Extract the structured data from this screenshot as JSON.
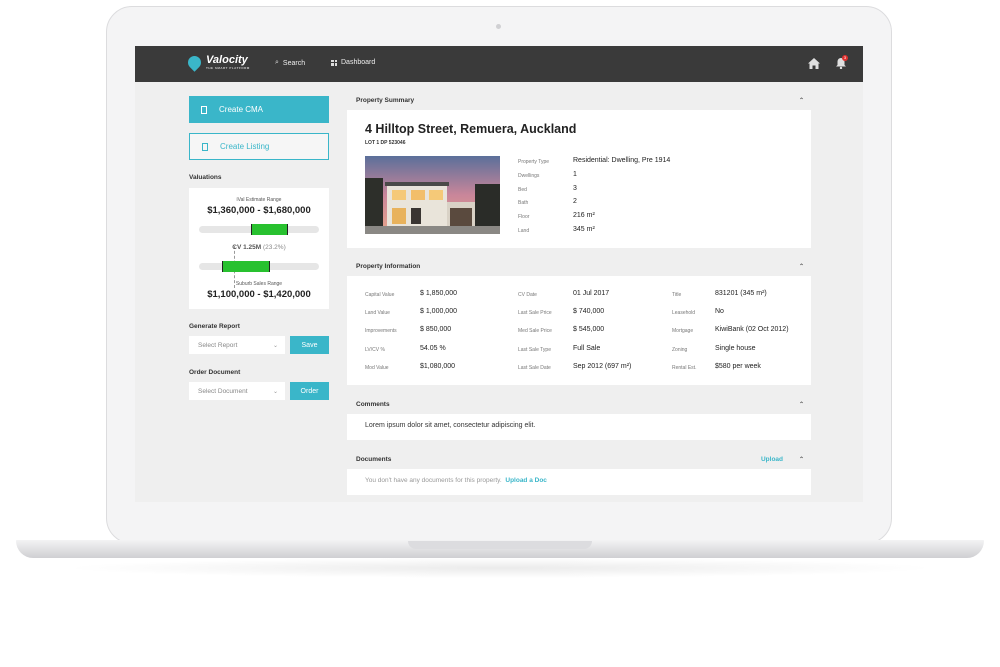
{
  "app": {
    "logo": "Valocity",
    "logo_sub": "THE SMART PLATFORM",
    "notification_count": "3"
  },
  "nav": {
    "search": "Search",
    "dashboard": "Dashboard"
  },
  "sidebar": {
    "create_cma": "Create CMA",
    "create_listing": "Create Listing",
    "valuations_label": "Valuations",
    "ival_caption": "iVal Estimate Range",
    "ival_range": "$1,360,000 - $1,680,000",
    "cv_label": "CV 1.25M",
    "cv_pct": "(23.2%)",
    "suburb_caption": "Suburb Sales Range",
    "suburb_range": "$1,100,000 - $1,420,000",
    "generate_report_label": "Generate Report",
    "report_placeholder": "Select Report",
    "save": "Save",
    "order_document_label": "Order Document",
    "document_placeholder": "Select Document",
    "order": "Order"
  },
  "summary": {
    "title": "Property Summary",
    "address": "4 Hilltop Street, Remuera, Auckland",
    "lot": "LOT 1 DP 523046",
    "fields": [
      {
        "label": "Property Type",
        "value": "Residential: Dwelling, Pre 1914"
      },
      {
        "label": "Dwellings",
        "value": "1"
      },
      {
        "label": "Bed",
        "value": "3"
      },
      {
        "label": "Bath",
        "value": "2"
      },
      {
        "label": "Floor",
        "value": "216 m²"
      },
      {
        "label": "Land",
        "value": "345 m²"
      }
    ]
  },
  "info": {
    "title": "Property Information",
    "col1": [
      {
        "label": "Capital Value",
        "value": "$ 1,850,000"
      },
      {
        "label": "Land Value",
        "value": "$ 1,000,000"
      },
      {
        "label": "Improvements",
        "value": "$ 850,000"
      },
      {
        "label": "LV/CV %",
        "value": "54.05 %"
      },
      {
        "label": "Mod Value",
        "value": "$1,080,000"
      }
    ],
    "col2": [
      {
        "label": "CV Date",
        "value": "01 Jul 2017"
      },
      {
        "label": "Last Sale Price",
        "value": "$ 740,000"
      },
      {
        "label": "Med Sale Price",
        "value": "$ 545,000"
      },
      {
        "label": "Last Sale Type",
        "value": "Full Sale"
      },
      {
        "label": "Last Sale Date",
        "value": "Sep 2012 (697 m²)"
      }
    ],
    "col3": [
      {
        "label": "Title",
        "value": "831201 (345 m²)"
      },
      {
        "label": "Leasehold",
        "value": "No"
      },
      {
        "label": "Mortgage",
        "value": "KiwiBank (02 Oct 2012)"
      },
      {
        "label": "Zoning",
        "value": "Single house"
      },
      {
        "label": "Rental Est.",
        "value": "$580 per week"
      }
    ]
  },
  "comments": {
    "title": "Comments",
    "text": "Lorem ipsum dolor sit amet, consectetur adipiscing elit."
  },
  "documents": {
    "title": "Documents",
    "upload": "Upload",
    "empty": "You don't have any documents for this property.",
    "upload_doc": "Upload a Doc"
  },
  "colors": {
    "accent": "#3ab6c9",
    "range_fill": "#28c12f",
    "topbar": "#3a3a3a",
    "badge": "#e0312f"
  }
}
